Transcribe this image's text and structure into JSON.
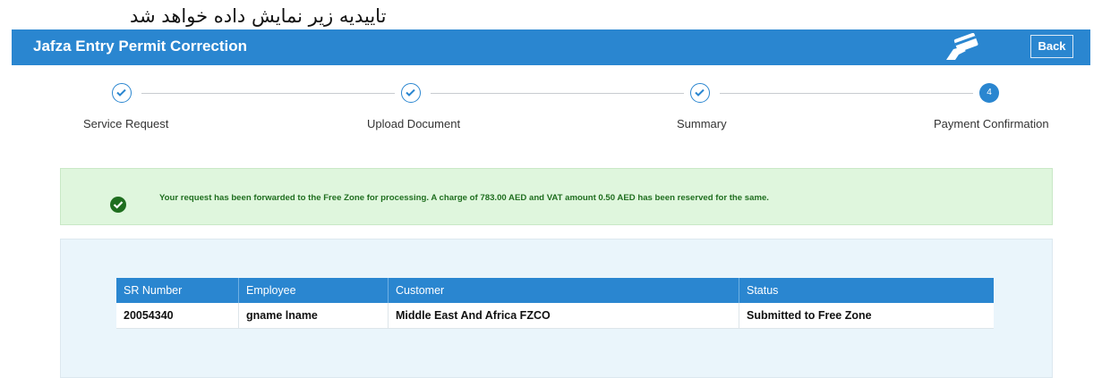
{
  "caption": "تاییدیه زیر نمایش داده خواهد شد",
  "header": {
    "title": "Jafza Entry Permit Correction",
    "back_label": "Back",
    "icon": "card-payment-icon"
  },
  "steps": [
    {
      "label": "Service Request",
      "state": "done"
    },
    {
      "label": "Upload Document",
      "state": "done"
    },
    {
      "label": "Summary",
      "state": "done"
    },
    {
      "label": "Payment Confirmation",
      "state": "active",
      "number": "4"
    }
  ],
  "alert": {
    "icon": "check-circle-icon",
    "message": "Your request has been forwarded to the Free Zone for processing. A charge of 783.00 AED and VAT amount 0.50 AED has been reserved for the same."
  },
  "table": {
    "headers": [
      "SR Number",
      "Employee",
      "Customer",
      "Status"
    ],
    "rows": [
      [
        "20054340",
        "gname lname",
        "Middle East And Africa FZCO",
        "Submitted to Free Zone"
      ]
    ]
  },
  "colors": {
    "accent": "#2a86d0",
    "success_bg": "#dff6dd",
    "success_text": "#1f6e1f",
    "panel_bg": "#eaf5fb"
  }
}
